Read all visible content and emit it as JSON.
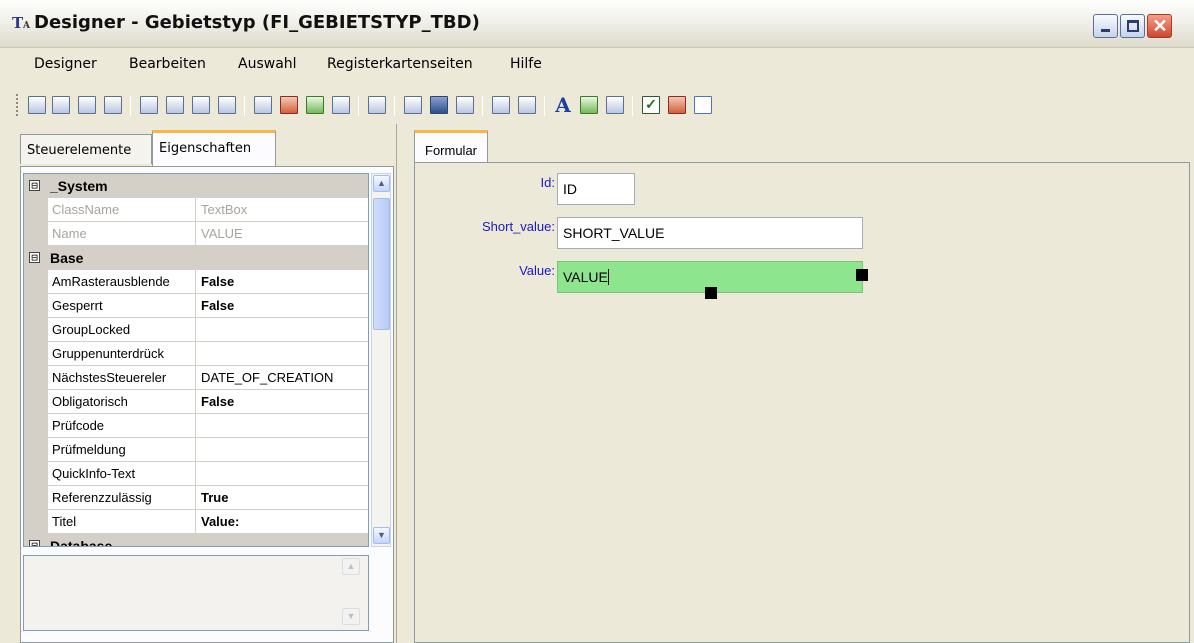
{
  "window": {
    "title": "Designer - Gebietstyp (FI_GEBIETSTYP_TBD)",
    "app_icon": "designer-app-icon",
    "controls": [
      "minimize-icon",
      "maximize-icon",
      "close-icon"
    ]
  },
  "menu": [
    "Designer",
    "Bearbeiten",
    "Auswahl",
    "Registerkartenseiten",
    "Hilfe"
  ],
  "toolbar": {
    "icons": [
      "label-icon",
      "sql-list-icon",
      "sql-combo-icon",
      "sql-tree-icon",
      "form-icon",
      "fid-icon",
      "sql-grid-icon",
      "filter-icon",
      "panel-icon",
      "color-grid-icon",
      "image-grid-icon",
      "list-edit-icon",
      "table-icon",
      "page-icon",
      "image-box-icon",
      "fid-box-icon",
      "text-icon",
      "api-icon",
      "font-a-icon",
      "image-icon",
      "frame-icon",
      "checkbox-icon",
      "grid-icon",
      "box-icon"
    ]
  },
  "left": {
    "tabs": [
      "Steuerelemente",
      "Eigenschaften"
    ],
    "active_tab": "Eigenschaften",
    "properties": [
      {
        "type": "category",
        "name": "_System",
        "toggle": "⊟"
      },
      {
        "type": "prop",
        "name": "ClassName",
        "value": "TextBox",
        "disabled": true
      },
      {
        "type": "prop",
        "name": "Name",
        "value": "VALUE",
        "disabled": true
      },
      {
        "type": "category",
        "name": "Base",
        "toggle": "⊟"
      },
      {
        "type": "prop",
        "name": "AmRasterausblende",
        "value": "False",
        "bold": true
      },
      {
        "type": "prop",
        "name": "Gesperrt",
        "value": "False",
        "bold": true
      },
      {
        "type": "prop",
        "name": "GroupLocked",
        "value": ""
      },
      {
        "type": "prop",
        "name": "Gruppenunterdrück",
        "value": ""
      },
      {
        "type": "prop",
        "name": "NächstesSteuereler",
        "value": "DATE_OF_CREATION"
      },
      {
        "type": "prop",
        "name": "Obligatorisch",
        "value": "False",
        "bold": true
      },
      {
        "type": "prop",
        "name": "Prüfcode",
        "value": ""
      },
      {
        "type": "prop",
        "name": "Prüfmeldung",
        "value": ""
      },
      {
        "type": "prop",
        "name": "QuickInfo-Text",
        "value": ""
      },
      {
        "type": "prop",
        "name": "Referenzzulässig",
        "value": "True",
        "bold": true
      },
      {
        "type": "prop",
        "name": "Titel",
        "value": "Value:",
        "bold": true
      },
      {
        "type": "category",
        "name": "Database",
        "toggle": "⊟"
      }
    ]
  },
  "right": {
    "tab": "Formular",
    "fields": [
      {
        "label": "Id:",
        "value": "ID"
      },
      {
        "label": "Short_value:",
        "value": "SHORT_VALUE"
      },
      {
        "label": "Value:",
        "value": "VALUE",
        "selected": true
      }
    ]
  }
}
